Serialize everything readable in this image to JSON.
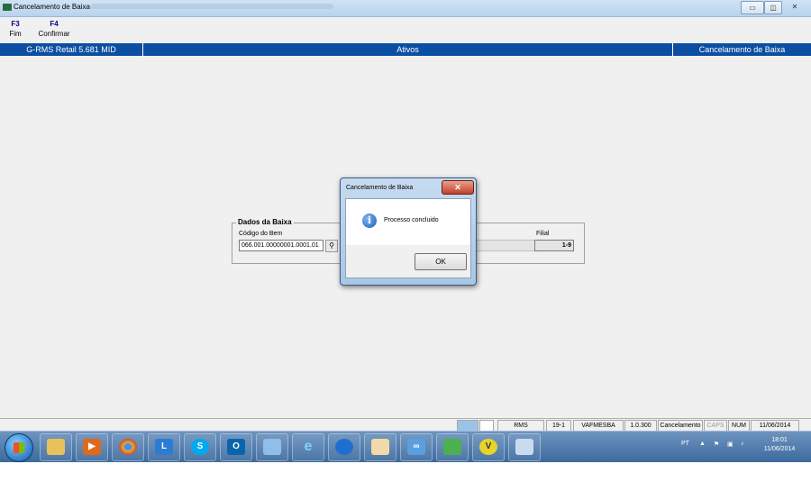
{
  "window": {
    "title": "Cancelamento de Baixa",
    "min": "▭",
    "max": "◫",
    "close": "✕"
  },
  "fkeys": [
    {
      "key": "F3",
      "label": "Fim"
    },
    {
      "key": "F4",
      "label": "Confirmar"
    }
  ],
  "header": {
    "app": "G-RMS Retail 5.681 MID",
    "section": "Ativos",
    "screen": "Cancelamento de Baixa"
  },
  "form": {
    "group_title": "Dados da Baixa",
    "codigo_label": "Código do Bem",
    "codigo_value": "066.001.00000001.0001.01",
    "filial_label": "Filial",
    "filial_value": "1-9"
  },
  "dialog": {
    "title": "Cancelamento de Baixa",
    "message": "Processo concluido",
    "ok": "OK",
    "close": "✕"
  },
  "statusbar": {
    "app": "RMS",
    "code": "19-1",
    "user": "VAFMESBA",
    "version": "1.0.300",
    "module": "Cancelamento",
    "caps": "CAPS",
    "num": "NUM",
    "date": "11/06/2014"
  },
  "taskbar": {
    "apps": [
      "S"
    ],
    "tray": {
      "lang": "PT",
      "time": "18:01",
      "date": "11/06/2014"
    }
  }
}
